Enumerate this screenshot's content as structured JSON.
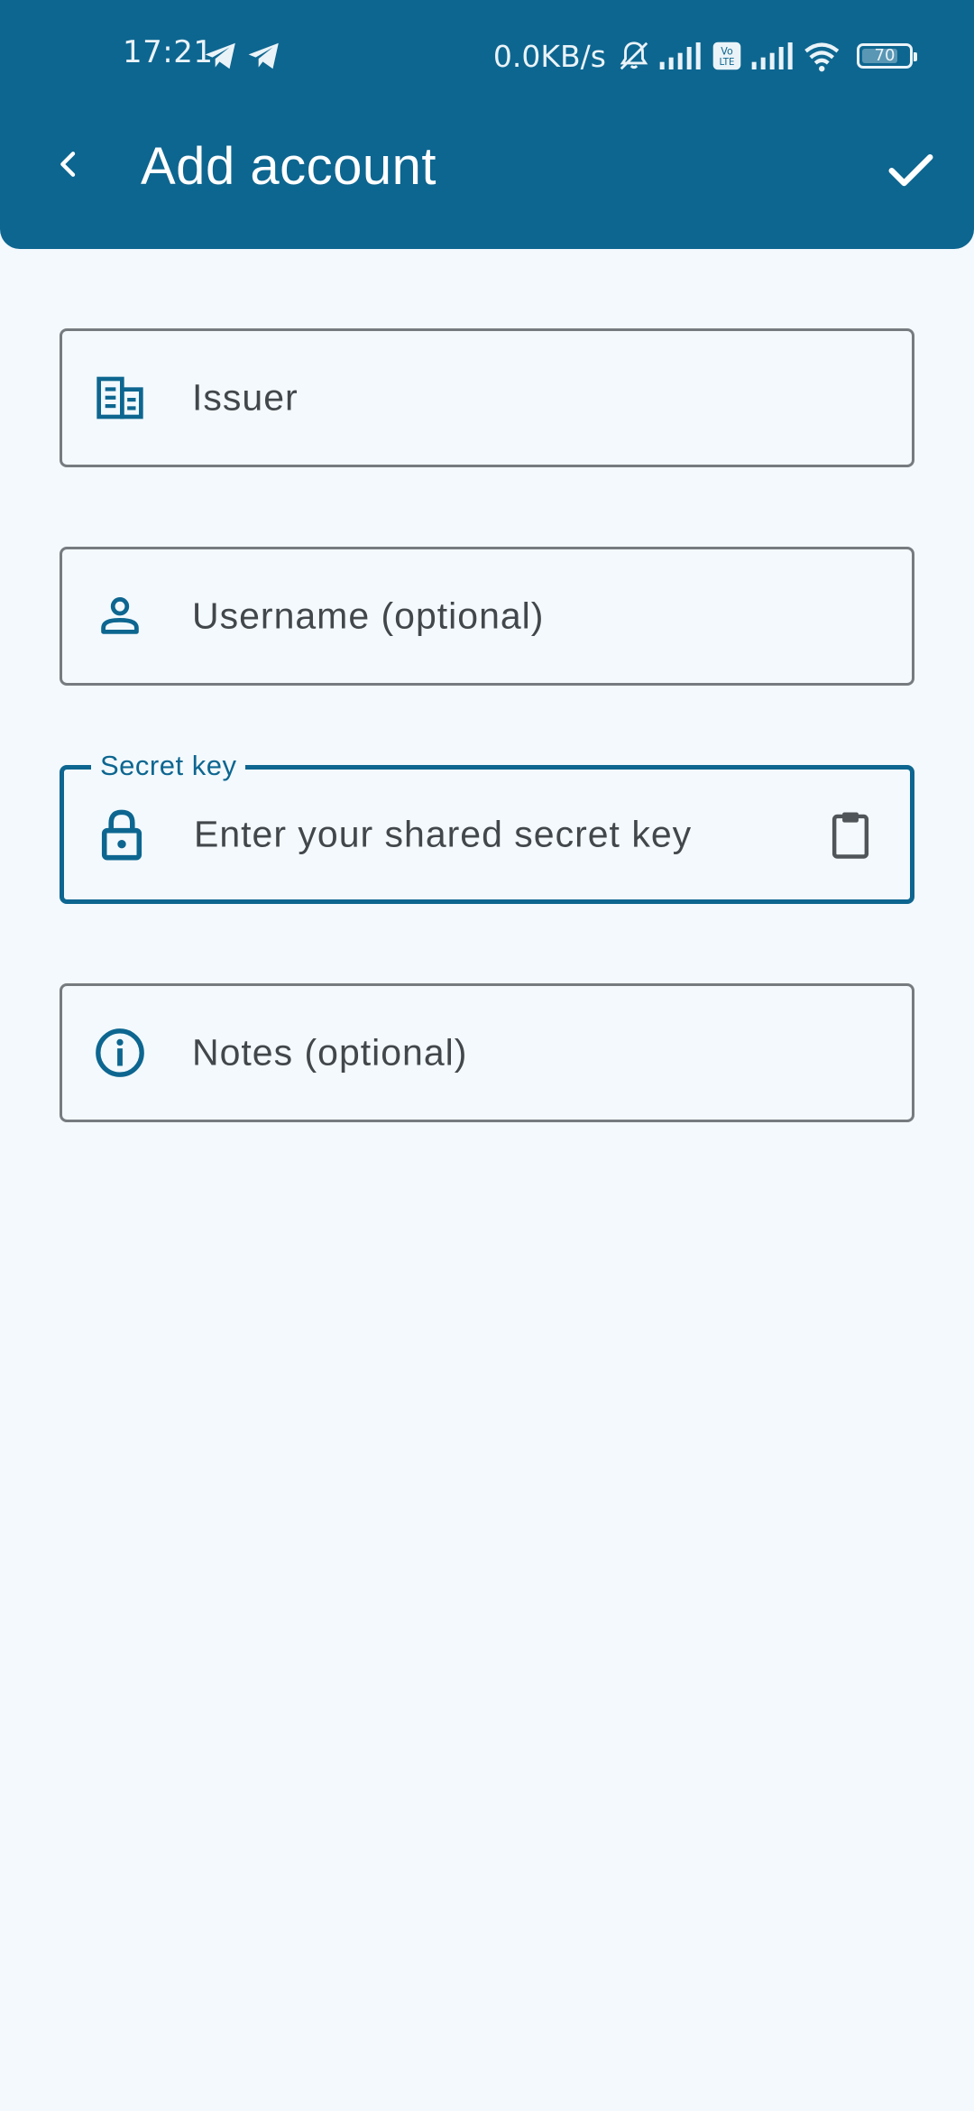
{
  "status_bar": {
    "time": "17:21",
    "network_speed": "0.0KB/s",
    "battery": "70"
  },
  "app_bar": {
    "title": "Add account"
  },
  "fields": {
    "issuer": {
      "placeholder": "Issuer"
    },
    "username": {
      "placeholder": "Username (optional)"
    },
    "secret_key": {
      "label": "Secret key",
      "placeholder": "Enter your shared secret key"
    },
    "notes": {
      "placeholder": "Notes (optional)"
    }
  },
  "colors": {
    "primary": "#0d6690",
    "background": "#f3f9fd",
    "outline": "#767b80",
    "text": "#42474c"
  },
  "icons": {
    "issuer": "building-icon",
    "username": "person-icon",
    "secret_key": "lock-icon",
    "paste": "clipboard-icon",
    "notes": "info-icon",
    "back": "back-arrow-icon",
    "save": "checkmark-icon"
  }
}
